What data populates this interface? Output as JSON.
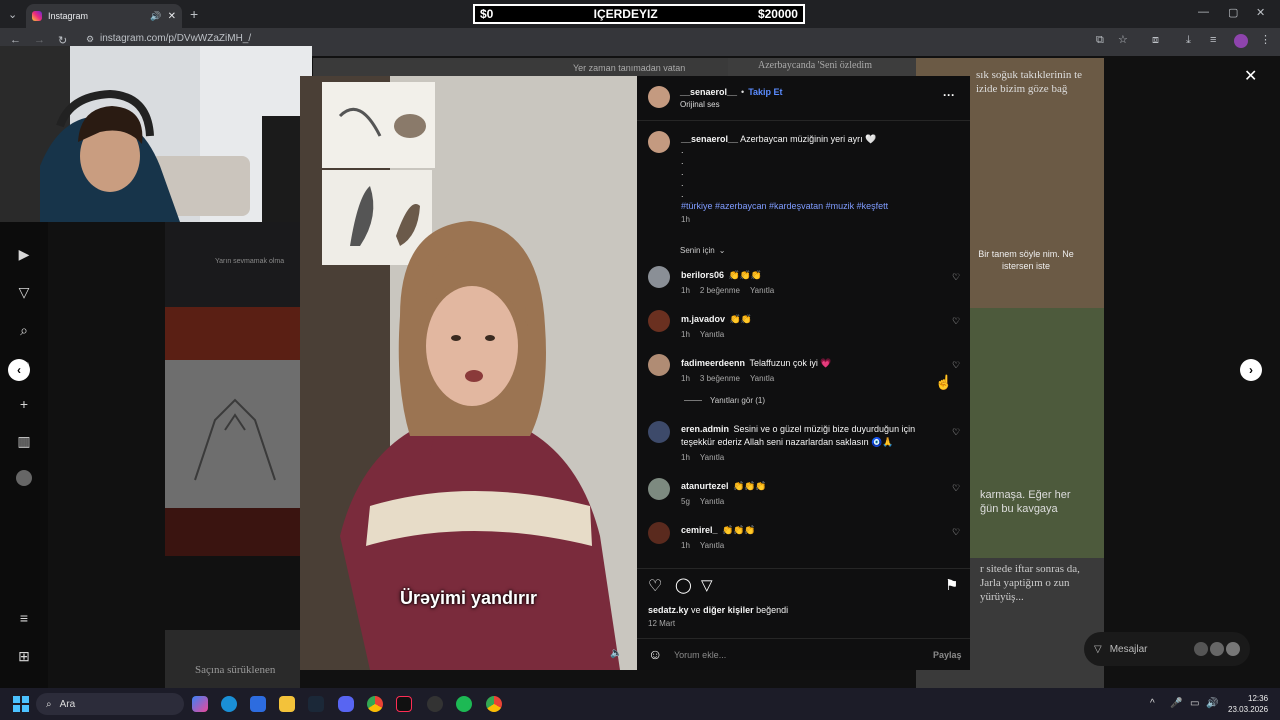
{
  "browser": {
    "tab_title": "Instagram",
    "url": "instagram.com/p/DVwWZaZiMH_/"
  },
  "overlay": {
    "left_amount": "$0",
    "center_text": "IÇERDEYIZ",
    "right_amount": "$20000"
  },
  "background_tiles": {
    "tile1": "Yarın sevmamak olma",
    "tile2": "Azerbaycanda 'Seni özledim",
    "tile3": "Yer zaman tanımadan vatan",
    "tile4": "sık soğuk takıklerinin te izide bizim göze bağ",
    "tile5": "Bir tanem söyle nim. Ne istersen iste",
    "tile6": "karmaşa. Eğer her ğün bu kavgaya",
    "tile7": "r sitede iftar sonras da, Jarla yaptiğım o zun yürüyüş...",
    "tile8": "Saçına sürüklenen"
  },
  "post": {
    "author": "__senaerol__",
    "follow_label": "Takip Et",
    "audio": "Orijinal ses",
    "caption_author": "__senaerol__",
    "caption_text": "Azerbaycan müziğinin yeri ayrı 🤍",
    "hashtags": "#türkiye #azerbaycan #kardeşvatan #muzik #keşfett",
    "caption_time": "1h",
    "sort_label": "Senin için",
    "subtitle": "Ürəyimi yandırır",
    "likes_user": "sedatz.ky",
    "likes_mid": "ve",
    "likes_others": "diğer kişiler",
    "likes_suffix": "beğendi",
    "date": "12 Mart",
    "comment_placeholder": "Yorum ekle...",
    "share_label": "Paylaş",
    "replies_label": "Yanıtları gör (1)"
  },
  "comments": [
    {
      "user": "berilors06",
      "text": "👏👏👏",
      "time": "1h",
      "likes": "2 beğenme",
      "reply": "Yanıtla"
    },
    {
      "user": "m.javadov",
      "text": "👏👏",
      "time": "1h",
      "likes": "",
      "reply": "Yanıtla"
    },
    {
      "user": "fadimeerdeenn",
      "text": "Telaffuzun çok iyi 💗",
      "time": "1h",
      "likes": "3 beğenme",
      "reply": "Yanıtla"
    },
    {
      "user": "eren.admin",
      "text": "Sesini ve o güzel müziği bize duyurduğun için teşekkür ederiz Allah seni nazarlardan saklasın 🧿🙏",
      "time": "1h",
      "likes": "",
      "reply": "Yanıtla"
    },
    {
      "user": "atanurtezel",
      "text": "👏👏👏",
      "time": "5g",
      "likes": "",
      "reply": "Yanıtla"
    },
    {
      "user": "cemirel_",
      "text": "👏👏👏",
      "time": "1h",
      "likes": "",
      "reply": "Yanıtla"
    }
  ],
  "messages_label": "Mesajlar",
  "taskbar": {
    "search_label": "Ara",
    "time": "12:36",
    "date": "23.03.2026"
  },
  "colors": {
    "accent_blue": "#5b8cff",
    "panel_bg": "#0f0f10",
    "sweater": "#7a2b3c"
  }
}
